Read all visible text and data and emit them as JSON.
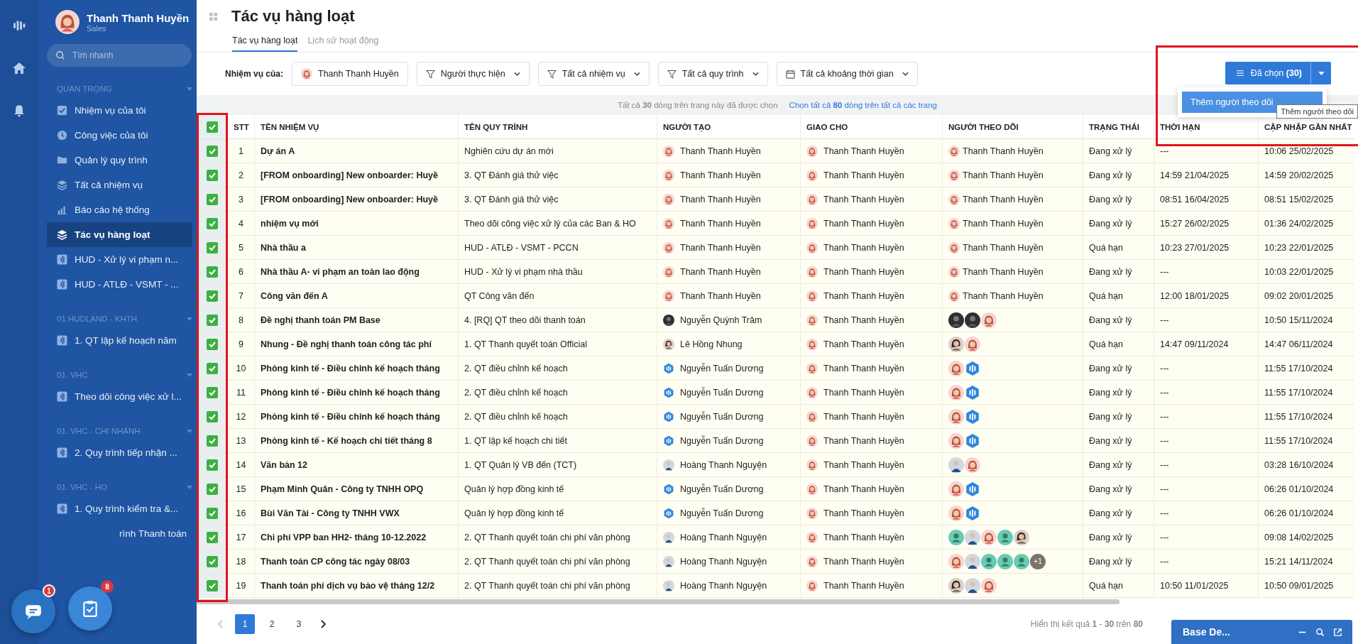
{
  "sidebar": {
    "user": {
      "name": "Thanh Thanh Huyền",
      "role": "Sales"
    },
    "search": {
      "placeholder": "Tìm nhanh"
    },
    "sections": [
      {
        "title": "QUAN TRỌNG",
        "items": [
          {
            "label": "Nhiệm vụ của tôi",
            "kind": "check",
            "selected": false
          },
          {
            "label": "Công việc của tôi",
            "kind": "clock",
            "selected": false
          },
          {
            "label": "Quản lý quy trình",
            "kind": "folder",
            "selected": false
          },
          {
            "label": "Tất cả nhiệm vụ",
            "kind": "layers",
            "selected": false
          },
          {
            "label": "Báo cáo hệ thống",
            "kind": "chart",
            "selected": false
          },
          {
            "label": "Tác vụ hàng loạt",
            "kind": "layers",
            "selected": true
          },
          {
            "label": "HUD - Xử lý vi phạm n...",
            "kind": "process",
            "selected": false
          },
          {
            "label": "HUD - ATLĐ - VSMT - ...",
            "kind": "process",
            "selected": false
          }
        ]
      },
      {
        "title": "01.HUDLAND - KHTH",
        "items": [
          {
            "label": "1. QT lập kế hoạch năm",
            "kind": "process",
            "selected": false
          }
        ]
      },
      {
        "title": "01. VHC",
        "items": [
          {
            "label": "Theo dõi công việc xử l...",
            "kind": "process",
            "selected": false
          }
        ]
      },
      {
        "title": "01. VHC - CHI NHÁNH",
        "items": [
          {
            "label": "2. Quy trình tiếp nhận ...",
            "kind": "process",
            "selected": false
          }
        ]
      },
      {
        "title": "01. VHC - HO",
        "items": [
          {
            "label": "1. Quy trình kiểm tra &...",
            "kind": "process",
            "selected": false
          },
          {
            "label": "rình Thanh toán",
            "kind": "covered",
            "selected": false
          }
        ]
      }
    ]
  },
  "floating_buttons": [
    {
      "kind": "chat",
      "badge": "1"
    },
    {
      "kind": "tasks",
      "badge": "8"
    }
  ],
  "page": {
    "title": "Tác vụ hàng loạt",
    "tabs": [
      {
        "label": "Tác vụ hàng loạt",
        "selected": true
      },
      {
        "label": "Lịch sử hoạt động",
        "selected": false
      }
    ]
  },
  "filters": {
    "label": "Nhiệm vụ của:",
    "items": [
      {
        "kind": "person",
        "label": "Thanh Thanh Huyền"
      },
      {
        "kind": "filter",
        "label": "Người thực hiện"
      },
      {
        "kind": "filter",
        "label": "Tất cả nhiệm vụ"
      },
      {
        "kind": "filter",
        "label": "Tất cả quy trình"
      },
      {
        "kind": "date",
        "label": "Tất cả khoảng thời gian"
      }
    ]
  },
  "bulk_action": {
    "label": "Đã chọn **(30)**",
    "menu": [
      {
        "label": "Thêm người theo dõi",
        "selected": true
      }
    ],
    "tooltip": "Thêm người theo dõi"
  },
  "notice": {
    "text": "Tất cả **30** dòng trên trang này đã được chọn",
    "link": "Chọn tất cả **80** dòng trên tất cả các trang"
  },
  "table": {
    "all_selected": true,
    "columns": [
      "STT",
      "TÊN NHIỆM VỤ",
      "TÊN QUY TRÌNH",
      "NGƯỜI TẠO",
      "GIAO CHO",
      "NGƯỜI THEO DÕI",
      "TRẠNG THÁI",
      "THỜI HẠN",
      "CẬP NHẬP GẦN NHẤT"
    ],
    "rows": [
      {
        "no": "1",
        "task": "Dự án A",
        "process": "Nghiên cứu dự án mới",
        "creator": {
          "name": "Thanh Thanh Huyền",
          "kind": "woman"
        },
        "assignee": {
          "name": "Thanh Thanh Huyền",
          "kind": "woman"
        },
        "followers": [
          {
            "name": "Thanh Thanh Huyền",
            "kind": "woman"
          }
        ],
        "status": "Đang xử lý",
        "deadline": "---",
        "updated": "10:06 25/02/2025",
        "selected": true
      },
      {
        "no": "2",
        "task": "[FROM onboarding] New onboarder: Huyề",
        "process": "3. QT Đánh giá thử việc",
        "creator": {
          "name": "Thanh Thanh Huyền",
          "kind": "woman"
        },
        "assignee": {
          "name": "Thanh Thanh Huyền",
          "kind": "woman"
        },
        "followers": [
          {
            "name": "Thanh Thanh Huyền",
            "kind": "woman"
          }
        ],
        "status": "Đang xử lý",
        "deadline": "14:59 21/04/2025",
        "updated": "14:59 20/02/2025",
        "selected": true
      },
      {
        "no": "3",
        "task": "[FROM onboarding] New onboarder: Huyề",
        "process": "3. QT Đánh giá thử việc",
        "creator": {
          "name": "Thanh Thanh Huyền",
          "kind": "woman"
        },
        "assignee": {
          "name": "Thanh Thanh Huyền",
          "kind": "woman"
        },
        "followers": [
          {
            "name": "Thanh Thanh Huyền",
            "kind": "woman"
          }
        ],
        "status": "Đang xử lý",
        "deadline": "08:51 16/04/2025",
        "updated": "08:51 15/02/2025",
        "selected": true
      },
      {
        "no": "4",
        "task": "nhiệm vụ mới",
        "process": "Theo dõi công việc xử lý của các Ban & HO",
        "creator": {
          "name": "Thanh Thanh Huyền",
          "kind": "woman"
        },
        "assignee": {
          "name": "Thanh Thanh Huyền",
          "kind": "woman"
        },
        "followers": [
          {
            "name": "Thanh Thanh Huyền",
            "kind": "woman"
          }
        ],
        "status": "Đang xử lý",
        "deadline": "15:27 26/02/2025",
        "updated": "01:36 24/02/2025",
        "selected": true
      },
      {
        "no": "5",
        "task": "Nhà thầu a",
        "process": "HUD - ATLĐ - VSMT - PCCN",
        "creator": {
          "name": "Thanh Thanh Huyền",
          "kind": "woman"
        },
        "assignee": {
          "name": "Thanh Thanh Huyền",
          "kind": "woman"
        },
        "followers": [
          {
            "name": "Thanh Thanh Huyền",
            "kind": "woman"
          }
        ],
        "status": "Quá hạn",
        "deadline": "10:23 27/01/2025",
        "updated": "10:23 22/01/2025",
        "selected": true
      },
      {
        "no": "6",
        "task": "Nhà thầu A- vi phạm an toàn lao động",
        "process": "HUD - Xử lý vi phạm nhà thầu",
        "creator": {
          "name": "Thanh Thanh Huyền",
          "kind": "woman"
        },
        "assignee": {
          "name": "Thanh Thanh Huyền",
          "kind": "woman"
        },
        "followers": [
          {
            "name": "Thanh Thanh Huyền",
            "kind": "woman"
          }
        ],
        "status": "Đang xử lý",
        "deadline": "---",
        "updated": "10:03 22/01/2025",
        "selected": true
      },
      {
        "no": "7",
        "task": "Công văn đến A",
        "process": "QT Công văn đến",
        "creator": {
          "name": "Thanh Thanh Huyền",
          "kind": "woman"
        },
        "assignee": {
          "name": "Thanh Thanh Huyền",
          "kind": "woman"
        },
        "followers": [
          {
            "name": "Thanh Thanh Huyền",
            "kind": "woman"
          }
        ],
        "status": "Quá hạn",
        "deadline": "12:00 18/01/2025",
        "updated": "09:02 20/01/2025",
        "selected": true
      },
      {
        "no": "8",
        "task": "Đề nghị thanh toán PM Base",
        "process": "4. [RQ] QT theo dõi thanh toán",
        "creator": {
          "name": "Nguyễn Quỳnh Trâm",
          "kind": "dark"
        },
        "assignee": {
          "name": "Thanh Thanh Huyền",
          "kind": "woman"
        },
        "followers": [
          {
            "kind": "dark"
          },
          {
            "kind": "dark"
          },
          {
            "kind": "woman"
          }
        ],
        "status": "Đang xử lý",
        "deadline": "---",
        "updated": "10:50 15/11/2024",
        "selected": true
      },
      {
        "no": "9",
        "task": "Nhung - Đề nghị thanh toán công tác phí",
        "process": "1. QT Thanh quyết toán Official",
        "creator": {
          "name": "Lê Hồng Nhung",
          "kind": "photo"
        },
        "assignee": {
          "name": "Thanh Thanh Huyền",
          "kind": "woman"
        },
        "followers": [
          {
            "kind": "photo"
          },
          {
            "kind": "woman"
          }
        ],
        "status": "Quá hạn",
        "deadline": "14:47 09/11/2024",
        "updated": "14:47 06/11/2024",
        "selected": true
      },
      {
        "no": "10",
        "task": "Phòng kinh tế - Điều chỉnh kế hoạch tháng",
        "process": "2. QT điều chỉnh kế hoạch",
        "creator": {
          "name": "Nguyễn Tuấn Dương",
          "kind": "logo"
        },
        "assignee": {
          "name": "Thanh Thanh Huyền",
          "kind": "woman"
        },
        "followers": [
          {
            "kind": "woman"
          },
          {
            "kind": "logo"
          }
        ],
        "status": "Đang xử lý",
        "deadline": "---",
        "updated": "11:55 17/10/2024",
        "selected": true
      },
      {
        "no": "11",
        "task": "Phòng kinh tế - Điều chỉnh kế hoạch tháng",
        "process": "2. QT điều chỉnh kế hoạch",
        "creator": {
          "name": "Nguyễn Tuấn Dương",
          "kind": "logo"
        },
        "assignee": {
          "name": "Thanh Thanh Huyền",
          "kind": "woman"
        },
        "followers": [
          {
            "kind": "woman"
          },
          {
            "kind": "logo"
          }
        ],
        "status": "Đang xử lý",
        "deadline": "---",
        "updated": "11:55 17/10/2024",
        "selected": true
      },
      {
        "no": "12",
        "task": "Phòng kinh tế - Điều chỉnh kế hoạch tháng",
        "process": "2. QT điều chỉnh kế hoạch",
        "creator": {
          "name": "Nguyễn Tuấn Dương",
          "kind": "logo"
        },
        "assignee": {
          "name": "Thanh Thanh Huyền",
          "kind": "woman"
        },
        "followers": [
          {
            "kind": "woman"
          },
          {
            "kind": "logo"
          }
        ],
        "status": "Đang xử lý",
        "deadline": "---",
        "updated": "11:55 17/10/2024",
        "selected": true
      },
      {
        "no": "13",
        "task": "Phòng kinh tế - Kế hoạch chi tiết tháng 8",
        "process": "1. QT lập kế hoạch chi tiết",
        "creator": {
          "name": "Nguyễn Tuấn Dương",
          "kind": "logo"
        },
        "assignee": {
          "name": "Thanh Thanh Huyền",
          "kind": "woman"
        },
        "followers": [
          {
            "kind": "woman"
          },
          {
            "kind": "logo"
          }
        ],
        "status": "Đang xử lý",
        "deadline": "---",
        "updated": "11:55 17/10/2024",
        "selected": true
      },
      {
        "no": "14",
        "task": "Văn bản 12",
        "process": "1. QT Quản lý VB đến (TCT)",
        "creator": {
          "name": "Hoàng Thanh Nguyện",
          "kind": "man"
        },
        "assignee": {
          "name": "Thanh Thanh Huyền",
          "kind": "woman"
        },
        "followers": [
          {
            "kind": "man"
          },
          {
            "kind": "woman"
          }
        ],
        "status": "Đang xử lý",
        "deadline": "---",
        "updated": "03:28 16/10/2024",
        "selected": true
      },
      {
        "no": "15",
        "task": "Phạm Minh Quân - Công ty TNHH OPQ",
        "process": "Quản lý hợp đồng kinh tế",
        "creator": {
          "name": "Nguyễn Tuấn Dương",
          "kind": "logo"
        },
        "assignee": {
          "name": "Thanh Thanh Huyền",
          "kind": "woman"
        },
        "followers": [
          {
            "kind": "woman"
          },
          {
            "kind": "logo"
          }
        ],
        "status": "Đang xử lý",
        "deadline": "---",
        "updated": "06:26 01/10/2024",
        "selected": true
      },
      {
        "no": "16",
        "task": "Bùi Văn Tài - Công ty TNHH VWX",
        "process": "Quản lý hợp đồng kinh tế",
        "creator": {
          "name": "Nguyễn Tuấn Dương",
          "kind": "logo"
        },
        "assignee": {
          "name": "Thanh Thanh Huyền",
          "kind": "woman"
        },
        "followers": [
          {
            "kind": "woman"
          },
          {
            "kind": "logo"
          }
        ],
        "status": "Đang xử lý",
        "deadline": "---",
        "updated": "06:26 01/10/2024",
        "selected": true
      },
      {
        "no": "17",
        "task": "Chi phí VPP ban HH2- tháng 10-12.2022",
        "process": "2. QT Thanh quyết toán chi phí văn phòng",
        "creator": {
          "name": "Hoàng Thanh Nguyện",
          "kind": "man"
        },
        "assignee": {
          "name": "Thanh Thanh Huyền",
          "kind": "woman"
        },
        "followers": [
          {
            "kind": "generic"
          },
          {
            "kind": "man"
          },
          {
            "kind": "woman"
          },
          {
            "kind": "generic"
          },
          {
            "kind": "photo"
          }
        ],
        "status": "Đang xử lý",
        "deadline": "---",
        "updated": "09:08 14/02/2025",
        "selected": true
      },
      {
        "no": "18",
        "task": "Thanh toán CP công tác ngày 08/03",
        "process": "2. QT Thanh quyết toán chi phí văn phòng",
        "creator": {
          "name": "Hoàng Thanh Nguyện",
          "kind": "man"
        },
        "assignee": {
          "name": "Thanh Thanh Huyền",
          "kind": "woman"
        },
        "followers": [
          {
            "kind": "woman"
          },
          {
            "kind": "man"
          },
          {
            "kind": "generic"
          },
          {
            "kind": "generic"
          },
          {
            "kind": "generic"
          }
        ],
        "more": "+1",
        "status": "Đang xử lý",
        "deadline": "---",
        "updated": "15:21 14/11/2024",
        "selected": true
      },
      {
        "no": "19",
        "task": "Thanh toán phí dịch vụ bảo vệ tháng 12/2",
        "process": "2. QT Thanh quyết toán chi phí văn phòng",
        "creator": {
          "name": "Hoàng Thanh Nguyện",
          "kind": "man"
        },
        "assignee": {
          "name": "Thanh Thanh Huyền",
          "kind": "woman"
        },
        "followers": [
          {
            "kind": "photo"
          },
          {
            "kind": "man"
          },
          {
            "kind": "woman"
          }
        ],
        "status": "Quá hạn",
        "deadline": "10:50 11/01/2025",
        "updated": "10:50 09/01/2025",
        "selected": true
      }
    ]
  },
  "pagination": {
    "pages": [
      {
        "label": "1",
        "selected": true
      },
      {
        "label": "2",
        "selected": false
      },
      {
        "label": "3",
        "selected": false
      }
    ],
    "summary": "Hiển thị kết quả **1** - **30** trên **80**"
  },
  "chat_panel": {
    "title": "Base De..."
  }
}
